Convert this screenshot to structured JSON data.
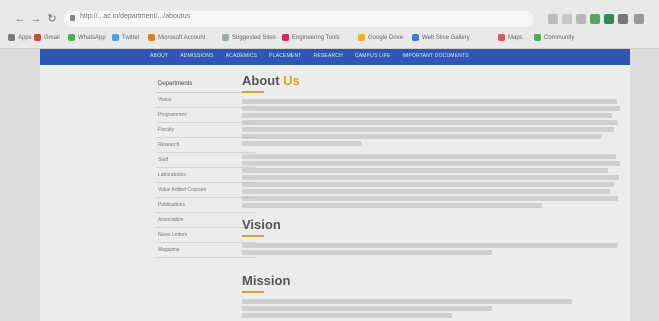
{
  "browser": {
    "url": "http://...ac.in/department/.../aboutus",
    "bookmarks": [
      "Apps",
      "Gmail",
      "WhatsApp",
      "Twitter",
      "Microsoft Account",
      "Suggested Sites",
      "Engineering Tools",
      "Google Drive",
      "Web Slice Gallery",
      "Maps",
      "Community"
    ]
  },
  "navbar": {
    "items": [
      "ABOUT",
      "ADMISSIONS",
      "ACADEMICS",
      "PLACEMENT",
      "RESEARCH",
      "CAMPUS LIFE",
      "IMPORTANT DOCUMENTS"
    ]
  },
  "sidebar": {
    "title": "Departments",
    "items": [
      "Vision",
      "Programmes",
      "Faculty",
      "Research",
      "Staff",
      "Laboratories",
      "Value Added Courses",
      "Publications",
      "Association",
      "News Letters",
      "Magazine"
    ]
  },
  "main": {
    "about_title_a": "About",
    "about_title_b": "Us",
    "vision_title": "Vision",
    "mission_title": "Mission"
  }
}
